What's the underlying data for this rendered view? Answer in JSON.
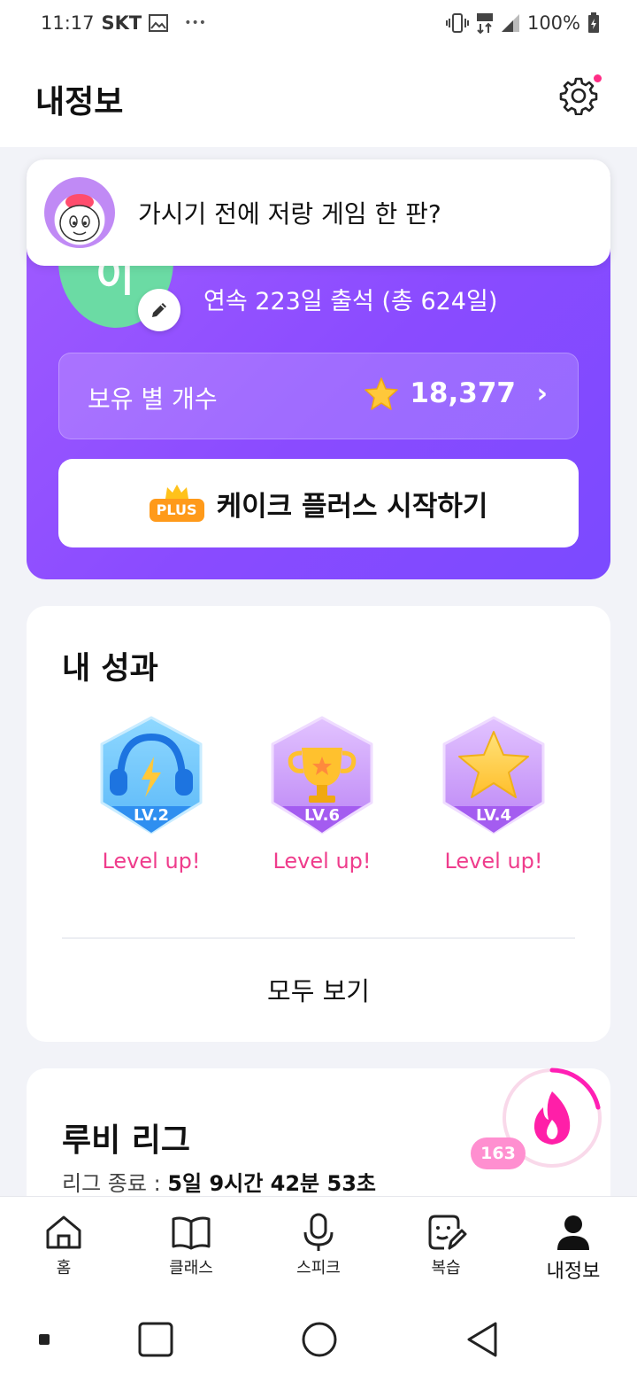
{
  "status_bar": {
    "time": "11:17",
    "carrier": "SKT",
    "battery": "100%"
  },
  "header": {
    "title": "내정보",
    "settings_icon": "gear-icon",
    "notification_color": "#ff2d86"
  },
  "banner": {
    "message": "가시기 전에 저랑 게임 한 판?"
  },
  "profile": {
    "avatar_initial": "이",
    "attendance": "연속 223일 출석 (총 624일)",
    "stars_label": "보유 별 개수",
    "stars_value": "18,377",
    "plus_badge": "PLUS",
    "plus_cta": "케이크 플러스 시작하기",
    "card_color": "#8a4bff"
  },
  "achievements": {
    "title": "내 성과",
    "badges": [
      {
        "icon": "headphones-icon",
        "level": "LV.2",
        "status": "Level up!"
      },
      {
        "icon": "trophy-icon",
        "level": "LV.6",
        "status": "Level up!"
      },
      {
        "icon": "star-icon",
        "level": "LV.4",
        "status": "Level up!"
      }
    ],
    "see_all": "모두 보기"
  },
  "league": {
    "title": "루비 리그",
    "ends_label": "리그 종료 :",
    "ends_value": "5일 9시간 42분 53초",
    "count": "163",
    "accent": "#ff2daf"
  },
  "bottom_nav": {
    "items": [
      {
        "label": "홈",
        "icon": "home-icon"
      },
      {
        "label": "클래스",
        "icon": "book-icon"
      },
      {
        "label": "스피크",
        "icon": "microphone-icon"
      },
      {
        "label": "복습",
        "icon": "review-icon"
      },
      {
        "label": "내정보",
        "icon": "person-icon",
        "active": true
      }
    ]
  }
}
